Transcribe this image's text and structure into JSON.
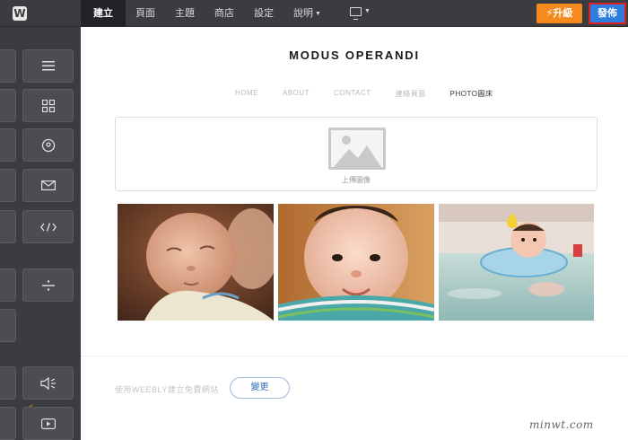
{
  "topbar": {
    "logo": "W",
    "tabs": [
      {
        "label": "建立"
      },
      {
        "label": "頁面"
      },
      {
        "label": "主題"
      },
      {
        "label": "商店"
      },
      {
        "label": "設定"
      },
      {
        "label": "說明"
      }
    ],
    "upgrade_label": "升級",
    "publish_label": "發佈"
  },
  "sidebar": {
    "icons": [
      "menu-icon",
      "grid-icon",
      "map-pin-icon",
      "mail-icon",
      "code-icon",
      "divider-icon",
      "speaker-icon",
      "video-icon"
    ]
  },
  "site": {
    "title": "MODUS OPERANDI",
    "nav": [
      "HOME",
      "ABOUT",
      "CONTACT",
      "連絡頁面",
      "PHOTO圖床"
    ],
    "upload_label": "上傳圖像",
    "footer_text": "使用WEEBLY建立免費網站",
    "change_label": "變更"
  },
  "watermark": "minwt.com",
  "colors": {
    "topbar": "#3a3c3f",
    "upgrade": "#f68a1f",
    "publish": "#2d7de0",
    "publish_highlight": "#e02020"
  }
}
